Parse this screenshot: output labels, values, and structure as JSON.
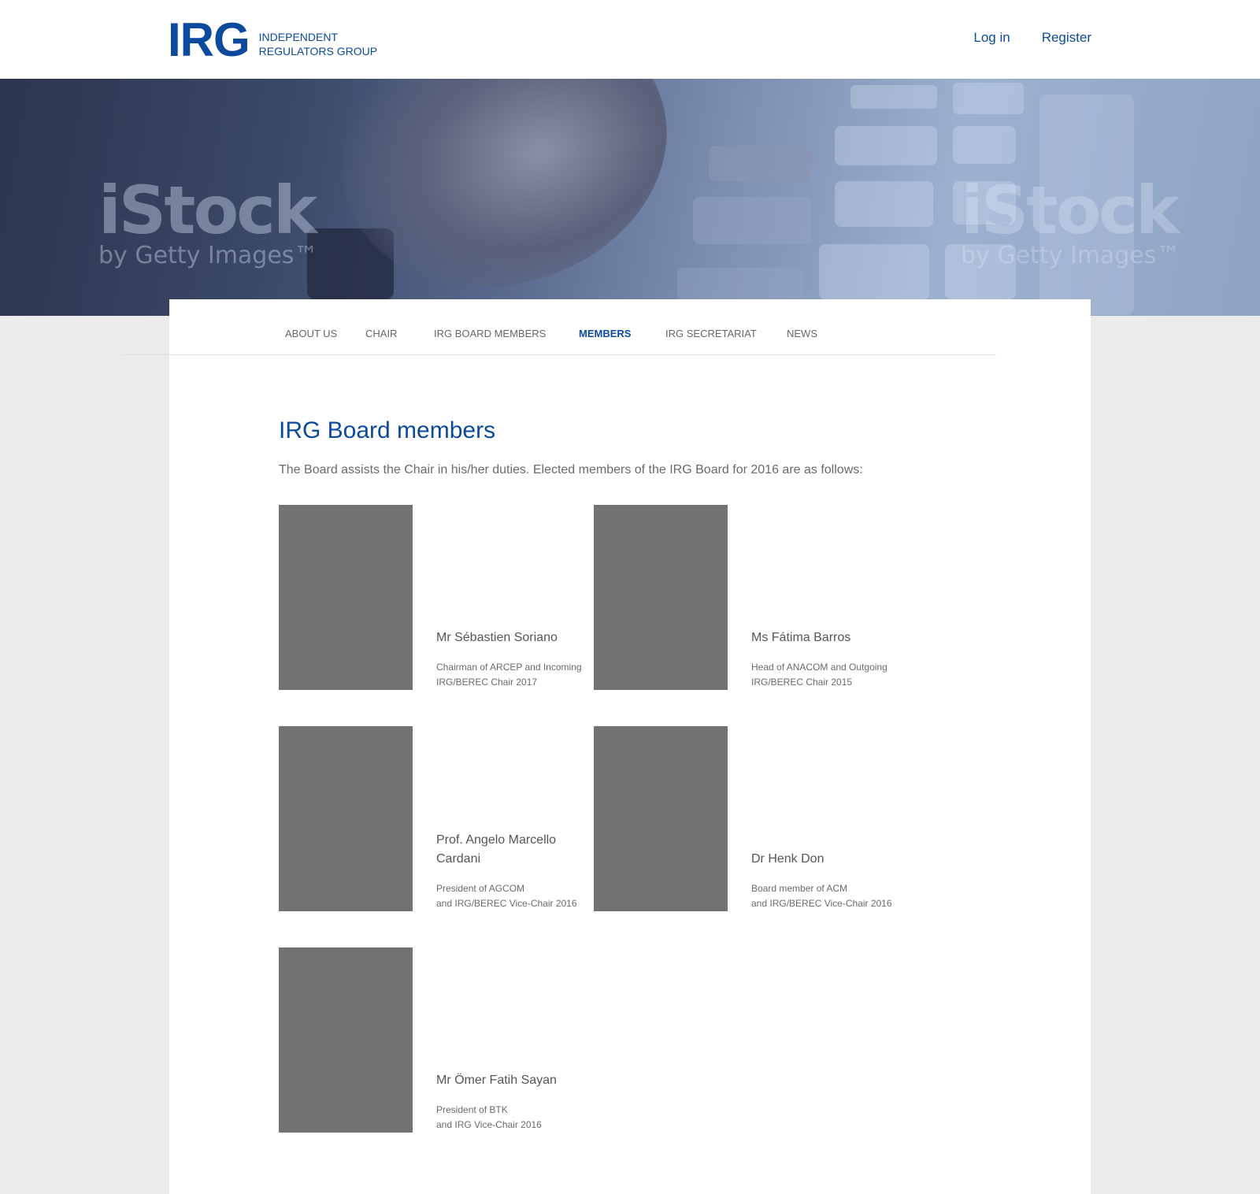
{
  "header": {
    "logo_mark": "IRG",
    "logo_sub_line1": "Independent",
    "logo_sub_line2": "Regulators Group",
    "login_label": "Log in",
    "register_label": "Register"
  },
  "hero": {
    "watermark_big": "iStock",
    "watermark_small": "by Getty Images™"
  },
  "nav": {
    "items": [
      {
        "label": "ABOUT US"
      },
      {
        "label": "CHAIR"
      },
      {
        "label": "IRG BOARD MEMBERS"
      },
      {
        "label": "MEMBERS",
        "active": true
      },
      {
        "label": "IRG SECRETARIAT"
      },
      {
        "label": "NEWS"
      }
    ]
  },
  "main": {
    "title": "IRG Board members",
    "intro": "The Board assists the Chair in his/her duties. Elected members of the IRG Board for 2016 are as follows:",
    "members": [
      {
        "name": "Mr Sébastien Soriano",
        "role": "Chairman of ARCEP and Incoming\nIRG/BEREC Chair 2017"
      },
      {
        "name": "Ms Fátima Barros",
        "role": "Head of ANACOM and Outgoing\nIRG/BEREC Chair 2015"
      },
      {
        "name": "Prof. Angelo Marcello Cardani",
        "role": "President of AGCOM\nand IRG/BEREC Vice-Chair 2016"
      },
      {
        "name": "Dr Henk Don",
        "role": "Board member of ACM\nand IRG/BEREC Vice-Chair 2016"
      },
      {
        "name": "Mr Ömer Fatih Sayan",
        "role": "President of BTK\nand IRG Vice-Chair 2016"
      }
    ]
  },
  "colors": {
    "brand": "#0b4a9d",
    "photo_placeholder": "#727272",
    "page_bg": "#ebebeb"
  }
}
